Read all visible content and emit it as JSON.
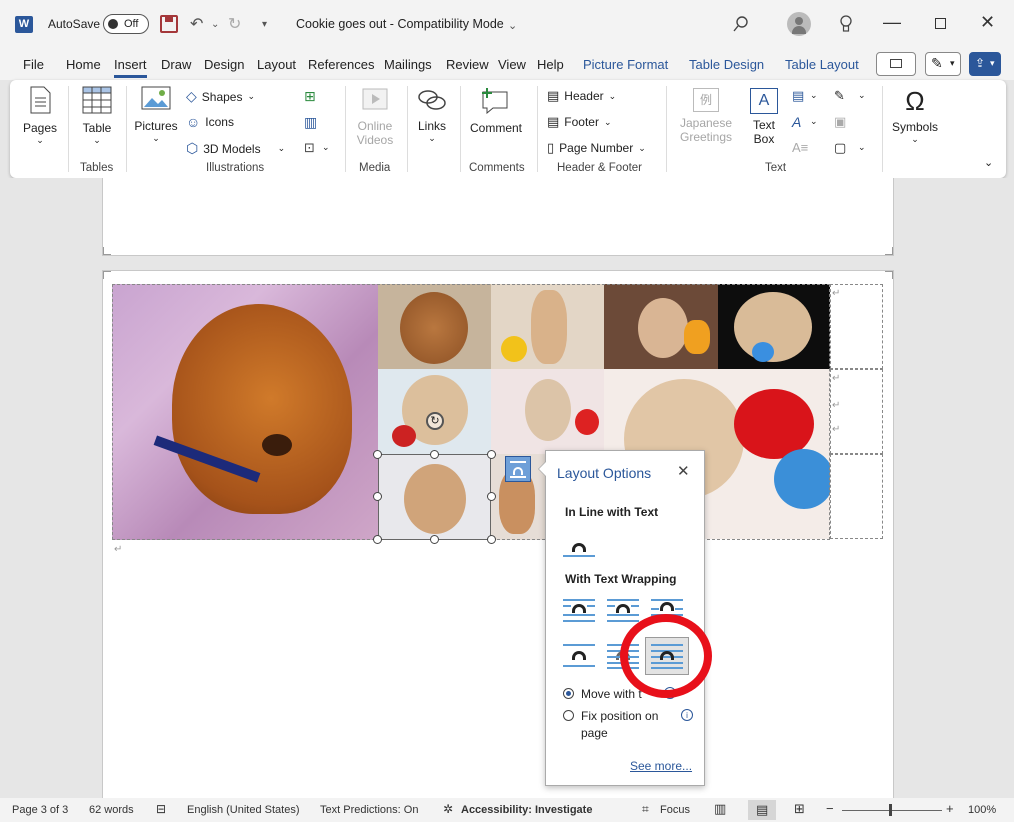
{
  "titlebar": {
    "autosave_label": "AutoSave",
    "autosave_state": "Off",
    "doc_title": "Cookie goes out  -  Compatibility Mode"
  },
  "menubar": {
    "tabs": [
      "File",
      "Home",
      "Insert",
      "Draw",
      "Design",
      "Layout",
      "References",
      "Mailings",
      "Review",
      "View",
      "Help"
    ],
    "context_tabs": [
      "Picture Format",
      "Table Design",
      "Table Layout"
    ],
    "active": "Insert"
  },
  "ribbon": {
    "pages": "Pages",
    "table": "Table",
    "tables_group": "Tables",
    "pictures": "Pictures",
    "shapes": "Shapes",
    "icons": "Icons",
    "models_3d": "3D Models",
    "illustrations_group": "Illustrations",
    "online_videos_1": "Online",
    "online_videos_2": "Videos",
    "media_group": "Media",
    "links": "Links",
    "comment": "Comment",
    "comments_group": "Comments",
    "header": "Header",
    "footer": "Footer",
    "page_number": "Page Number",
    "header_footer_group": "Header & Footer",
    "japanese_1": "Japanese",
    "japanese_2": "Greetings",
    "textbox_1": "Text",
    "textbox_2": "Box",
    "text_group": "Text",
    "symbols": "Symbols"
  },
  "layout_options": {
    "title": "Layout Options",
    "inline_heading": "In Line with Text",
    "wrapping_heading": "With Text Wrapping",
    "move_with_text": "Move with t",
    "fix_position_1": "Fix position on",
    "fix_position_2": "page",
    "see_more": "See more..."
  },
  "status": {
    "page": "Page 3 of 3",
    "words": "62 words",
    "language": "English (United States)",
    "predictions": "Text Predictions: On",
    "accessibility": "Accessibility: Investigate",
    "focus": "Focus",
    "zoom": "100%"
  },
  "colors": {
    "accent": "#2b579a",
    "highlight_circle": "#e8101a"
  }
}
